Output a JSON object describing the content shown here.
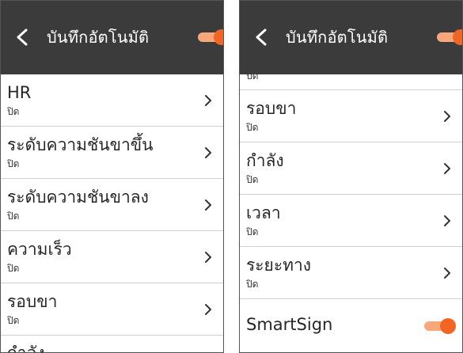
{
  "colors": {
    "header_bg": "#3b3b3b",
    "accent": "#f26522",
    "accent_track": "#f8a77a",
    "divider": "#cfcfcf",
    "text": "#262626"
  },
  "left": {
    "header": {
      "title": "บันทึกอัตโนมัติ",
      "back_icon": "chevron-left-icon",
      "toggle_on": true
    },
    "items": [
      {
        "title": "HR",
        "value": "ปิด"
      },
      {
        "title": "ระดับความชันขาขึ้น",
        "value": "ปิด"
      },
      {
        "title": "ระดับความชันขาลง",
        "value": "ปิด"
      },
      {
        "title": "ความเร็ว",
        "value": "ปิด"
      },
      {
        "title": "รอบขา",
        "value": "ปิด"
      }
    ],
    "partial_bottom_title": "กำลัง"
  },
  "right": {
    "header": {
      "title": "บันทึกอัตโนมัติ",
      "back_icon": "chevron-left-icon",
      "toggle_on": true
    },
    "partial_top_value": "ปิด",
    "items": [
      {
        "title": "รอบขา",
        "value": "ปิด"
      },
      {
        "title": "กำลัง",
        "value": "ปิด"
      },
      {
        "title": "เวลา",
        "value": "ปิด"
      },
      {
        "title": "ระยะทาง",
        "value": "ปิด"
      }
    ],
    "switch_item": {
      "title": "SmartSign",
      "toggle_on": true
    }
  }
}
